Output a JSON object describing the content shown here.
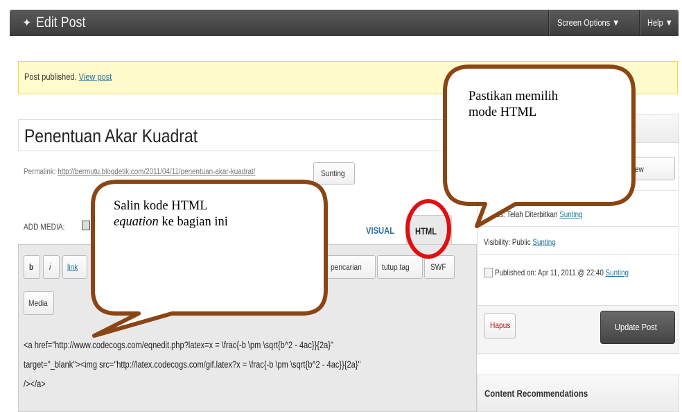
{
  "header": {
    "title": "Edit Post",
    "screen_options": "Screen Options",
    "help": "Help"
  },
  "notice": {
    "text": "Post published.",
    "link": "View post"
  },
  "post": {
    "title": "Penentuan Akar Kuadrat",
    "permalink_label": "Permalink:",
    "permalink_url": "http://bermutu.blogdetik.com/2011/04/11/penentuan-akar-kuadrat/",
    "edit_button": "Sunting"
  },
  "editor": {
    "add_media": "ADD MEDIA:",
    "tab_visual": "VISUAL",
    "tab_html": "HTML",
    "quicktags": [
      "b",
      "i",
      "link",
      "pencarian",
      "tutup tag",
      "SWF",
      "Media"
    ],
    "code_lines": [
      "<a href=\"http://www.codecogs.com/eqnedit.php?latex=x = \\frac{-b \\pm \\sqrt{b^2 - 4ac}}{2a}\"",
      "target=\"_blank\"><img src=\"http://latex.codecogs.com/gif.latex?x = \\frac{-b \\pm \\sqrt{b^2 - 4ac}}{2a}\"",
      "/></a>"
    ]
  },
  "publish": {
    "preview": "view",
    "status_label": "Status: Telah Diterbitkan",
    "status_link": "Sunting",
    "visibility_label": "Visibility: Public",
    "visibility_link": "Sunting",
    "published_label": "Published on: Apr 11, 2011 @ 22:40",
    "published_link": "Sunting",
    "delete": "Hapus",
    "update": "Update Post"
  },
  "content_recommendations": "Content Recommendations",
  "callouts": {
    "left_line1": "Salin kode HTML",
    "left_line2_italic": "equation",
    "left_line2_rest": " ke bagian ini",
    "right_line1": "Pastikan memilih",
    "right_line2": "mode HTML"
  },
  "colors": {
    "callout_border": "#8b4513",
    "highlight_ring": "#e01010",
    "link": "#21759b"
  }
}
